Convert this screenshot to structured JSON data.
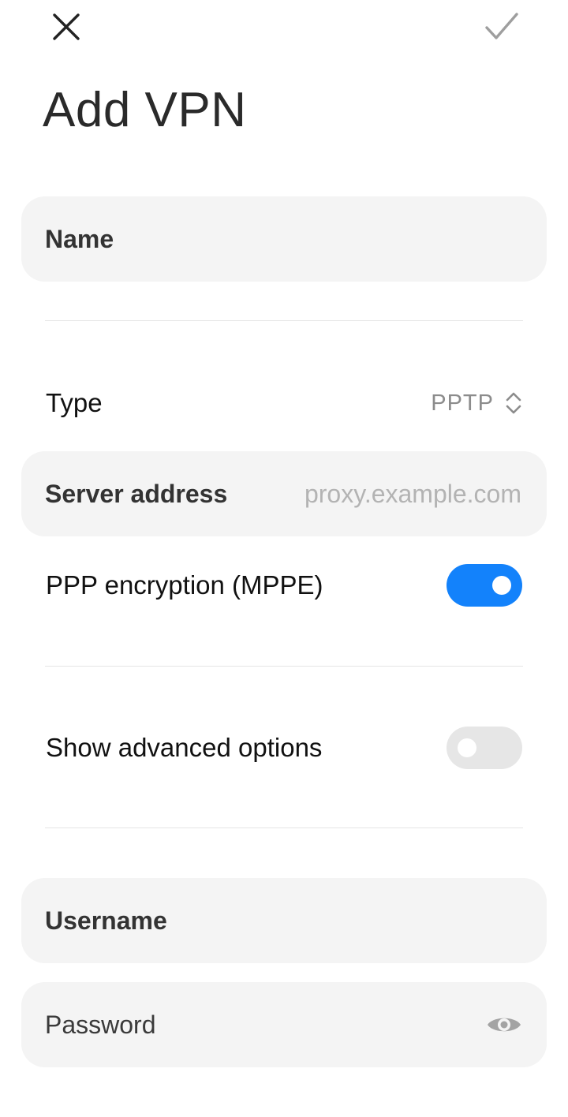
{
  "header": {
    "title": "Add VPN"
  },
  "form": {
    "name": {
      "label": "Name",
      "value": ""
    },
    "type": {
      "label": "Type",
      "value": "PPTP"
    },
    "server": {
      "label": "Server address",
      "placeholder": "proxy.example.com",
      "value": ""
    },
    "encryption": {
      "label": "PPP encryption (MPPE)",
      "enabled": true
    },
    "advanced": {
      "label": "Show advanced options",
      "enabled": false
    },
    "username": {
      "label": "Username",
      "value": ""
    },
    "password": {
      "label": "Password",
      "value": ""
    }
  },
  "colors": {
    "accent": "#1382fb",
    "field_bg": "#f4f4f4",
    "toggle_off": "#e6e6e6"
  },
  "icons": {
    "close": "close-icon",
    "confirm": "checkmark-icon",
    "type_selector": "chevron-up-down-icon",
    "password_visibility": "eye-icon"
  }
}
